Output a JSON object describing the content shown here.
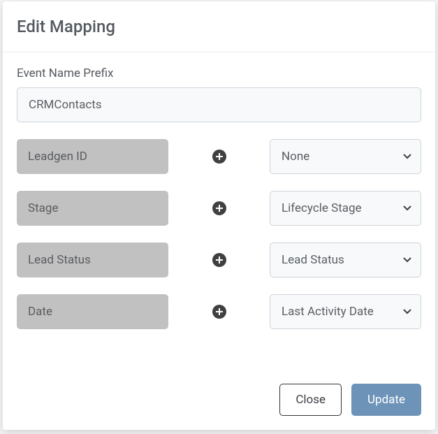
{
  "modal": {
    "title": "Edit Mapping",
    "prefix_label": "Event Name Prefix",
    "prefix_value": "CRMContacts",
    "rows": [
      {
        "left": "Leadgen ID",
        "right": "None"
      },
      {
        "left": "Stage",
        "right": "Lifecycle Stage"
      },
      {
        "left": "Lead Status",
        "right": "Lead Status"
      },
      {
        "left": "Date",
        "right": "Last Activity Date"
      }
    ],
    "buttons": {
      "close": "Close",
      "update": "Update"
    }
  }
}
